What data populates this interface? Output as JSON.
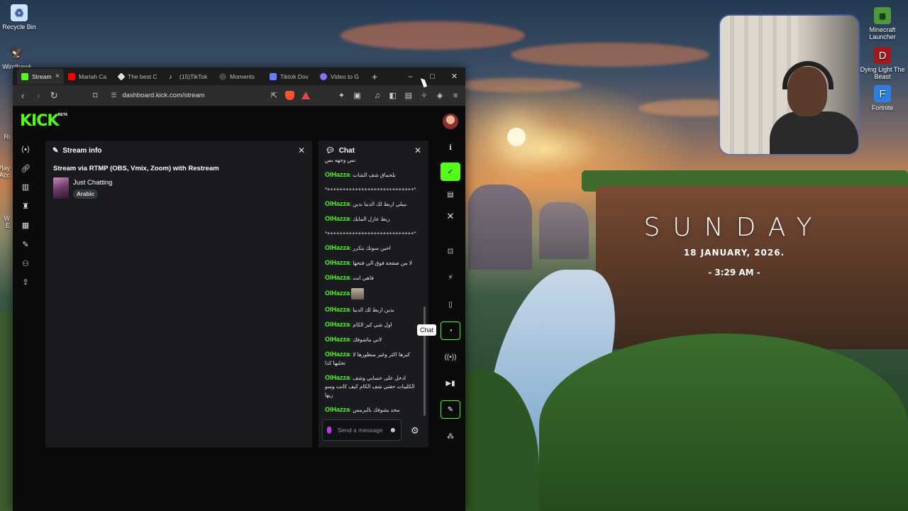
{
  "desktop": {
    "icons_left": [
      {
        "label": "Recycle Bin",
        "icon": "recycle-bin-icon"
      },
      {
        "label": "Windhawk",
        "icon": "windhawk-icon"
      }
    ],
    "icons_left_partial": [
      "Ri",
      "Play",
      "Acc",
      "W",
      "E"
    ],
    "icons_right": [
      {
        "label": "Minecraft Launcher",
        "icon": "minecraft-icon"
      },
      {
        "label": "Dying Light The Beast",
        "icon": "dying-light-icon"
      },
      {
        "label": "Fortnite",
        "icon": "fortnite-icon"
      }
    ],
    "widget": {
      "day": "SUNDAY",
      "date": "18  JANUARY, 2026.",
      "time": "- 3:29 AM -"
    }
  },
  "browser": {
    "tabs": [
      {
        "label": "Stream",
        "color": "#53fc18",
        "active": true
      },
      {
        "label": "Mariah Ca",
        "color": "#ff0000"
      },
      {
        "label": "The best C",
        "color": "#dddddd"
      },
      {
        "label": "(15)TikTok",
        "color": "#ffffff"
      },
      {
        "label": "Moments",
        "color": "#444444"
      },
      {
        "label": "Tiktok Dov",
        "color": "#6a7cff"
      },
      {
        "label": "Video to G",
        "color": "#8a6cff"
      }
    ],
    "tab_close": "×",
    "new_tab": "+",
    "window_controls": {
      "minimize": "–",
      "maximize": "□",
      "close": "✕"
    },
    "url": "dashboard.kick.com/stream",
    "brave_badge": "2"
  },
  "kick": {
    "logo": "KICK",
    "logo_badge": "BETA",
    "left_rail": [
      "stream-icon",
      "link-icon",
      "chart-icon",
      "trophy-icon",
      "video-icon",
      "wrench-icon",
      "users-icon",
      "upload-icon"
    ],
    "stream_info": {
      "title": "Stream info",
      "stream_title": "Stream via RTMP (OBS, Vmix, Zoom) with Restream",
      "category": "Just Chatting",
      "tag": "Arabic",
      "close": "✕"
    },
    "chat": {
      "title": "Chat",
      "close": "✕",
      "messages": [
        {
          "user": "",
          "text": "نس وجهه بس"
        },
        {
          "user": "OlHazza",
          "text": ": بلحماق شف الشات"
        },
        {
          "user": "",
          "text": "*++++++++++++++++++++++++++++*"
        },
        {
          "user": "OlHazza",
          "text": ": بيبلي ازبط لك الدنيا بدين"
        },
        {
          "user": "OlHazza",
          "text": ": زبط عازل المايك"
        },
        {
          "user": "",
          "text": "*++++++++++++++++++++++++++++*"
        },
        {
          "user": "OlHazza",
          "text": ": احين سوتك يتكرر"
        },
        {
          "user": "OlHazza",
          "text": ": لا من صفحة فوق الي فتحها"
        },
        {
          "user": "OlHazza",
          "text": ": فاهي انت"
        },
        {
          "user": "OlHazza",
          "text": ":",
          "emote": true
        },
        {
          "user": "OlHazza",
          "text": ": بدين ازبط لك الدنيا"
        },
        {
          "user": "OlHazza",
          "text": ": اول شي كبر الكام"
        },
        {
          "user": "OlHazza",
          "text": ": لاني ماشوفك"
        },
        {
          "user": "OlHazza",
          "text": ": كبرها اكثر وغير منظورها لا تخليها كذا"
        },
        {
          "user": "OlHazza",
          "text": ": ادخل على حسابي وشف الكليبات حقتي شف الكام كيف كانت وسو زيها"
        },
        {
          "user": "OlHazza",
          "text": ": محد يشوفك بالبرمس"
        },
        {
          "user": "",
          "text": "*++++++++++++++++++++++++++++*"
        }
      ],
      "input_placeholder": "Send a message",
      "tooltip": "Chat"
    },
    "right_rail": [
      "info-icon",
      "check-icon",
      "layout-icon",
      "close-icon",
      "camera-icon",
      "lightning-icon",
      "document-icon",
      "chat-icon",
      "broadcast-icon",
      "video-camera-icon",
      "wrench-icon",
      "puzzle-icon"
    ]
  }
}
